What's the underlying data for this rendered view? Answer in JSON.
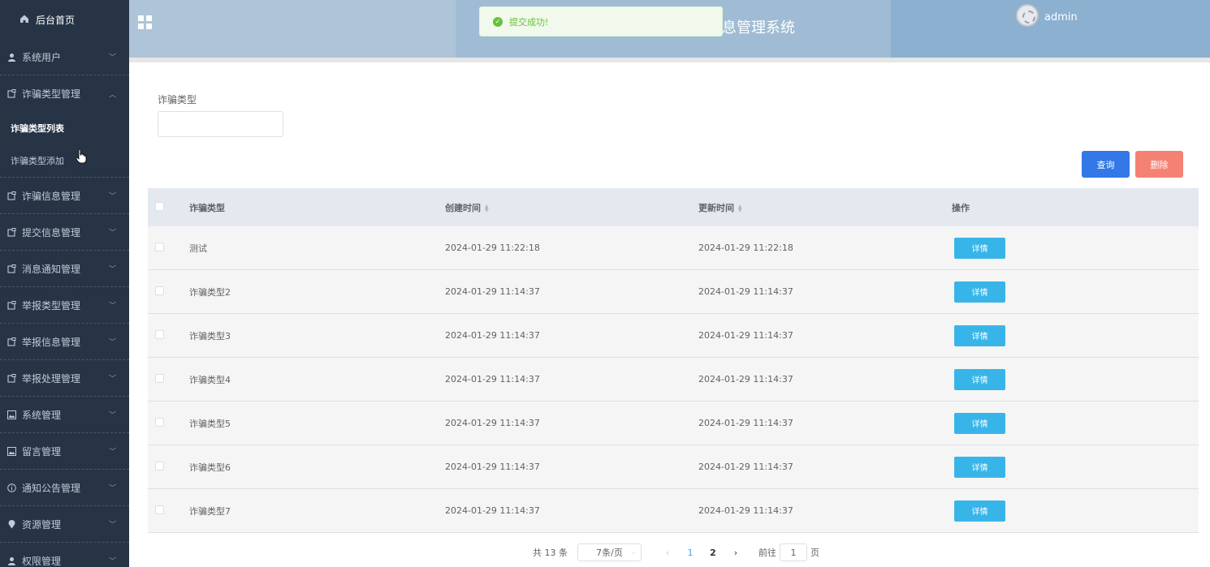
{
  "sidebar": {
    "home": "后台首页",
    "items": [
      {
        "label": "系统用户",
        "icon": "user-icon"
      },
      {
        "label": "诈骗类型管理",
        "icon": "doc-icon",
        "expanded": true
      },
      {
        "label": "诈骗信息管理",
        "icon": "doc-icon"
      },
      {
        "label": "提交信息管理",
        "icon": "doc-icon"
      },
      {
        "label": "消息通知管理",
        "icon": "doc-icon"
      },
      {
        "label": "举报类型管理",
        "icon": "doc-icon"
      },
      {
        "label": "举报信息管理",
        "icon": "doc-icon"
      },
      {
        "label": "举报处理管理",
        "icon": "doc-icon"
      },
      {
        "label": "系统管理",
        "icon": "picture-icon"
      },
      {
        "label": "留言管理",
        "icon": "picture-icon"
      },
      {
        "label": "通知公告管理",
        "icon": "info-icon"
      },
      {
        "label": "资源管理",
        "icon": "location-icon"
      },
      {
        "label": "权限管理",
        "icon": "user-icon"
      }
    ],
    "subitems": [
      {
        "label": "诈骗类型列表",
        "active": true
      },
      {
        "label": "诈骗类型添加",
        "active": false
      }
    ]
  },
  "header": {
    "title": "息管理系统",
    "user": "admin"
  },
  "toast": {
    "message": "提交成功!"
  },
  "filter": {
    "label": "诈骗类型",
    "value": ""
  },
  "buttons": {
    "search": "查询",
    "delete": "删除"
  },
  "table": {
    "columns": [
      "诈骗类型",
      "创建时间",
      "更新时间",
      "操作"
    ],
    "detail_label": "详情",
    "rows": [
      {
        "type": "测试",
        "created": "2024-01-29 11:22:18",
        "updated": "2024-01-29 11:22:18"
      },
      {
        "type": "诈骗类型2",
        "created": "2024-01-29 11:14:37",
        "updated": "2024-01-29 11:14:37"
      },
      {
        "type": "诈骗类型3",
        "created": "2024-01-29 11:14:37",
        "updated": "2024-01-29 11:14:37"
      },
      {
        "type": "诈骗类型4",
        "created": "2024-01-29 11:14:37",
        "updated": "2024-01-29 11:14:37"
      },
      {
        "type": "诈骗类型5",
        "created": "2024-01-29 11:14:37",
        "updated": "2024-01-29 11:14:37"
      },
      {
        "type": "诈骗类型6",
        "created": "2024-01-29 11:14:37",
        "updated": "2024-01-29 11:14:37"
      },
      {
        "type": "诈骗类型7",
        "created": "2024-01-29 11:14:37",
        "updated": "2024-01-29 11:14:37"
      }
    ]
  },
  "pagination": {
    "total": "共 13 条",
    "page_size": "7条/页",
    "pages": [
      "1",
      "2"
    ],
    "current": "1",
    "goto_prefix": "前往",
    "goto_value": "1",
    "goto_suffix": "页"
  }
}
